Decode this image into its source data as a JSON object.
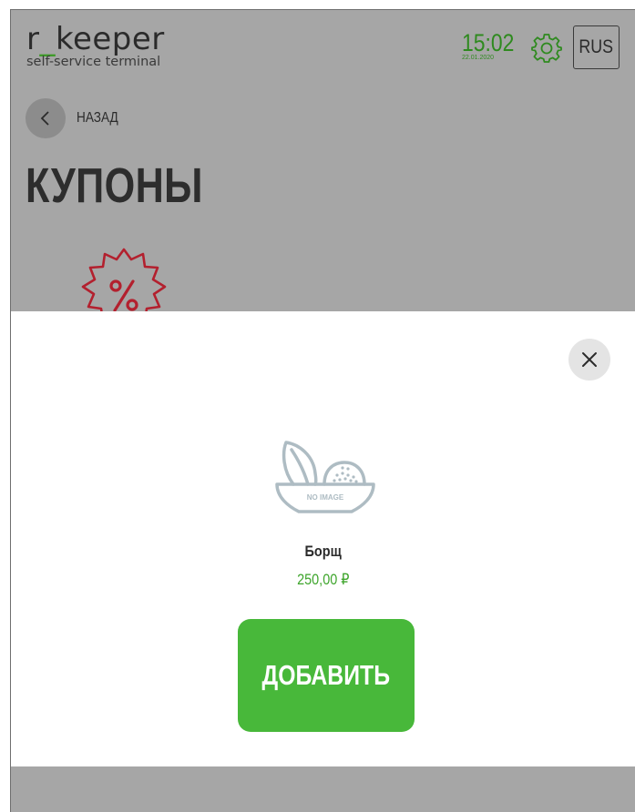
{
  "header": {
    "logo_prefix": "r",
    "logo_underscore": "_",
    "logo_suffix": "keeper",
    "logo_subtitle": "self-service terminal",
    "time": "15:02",
    "date": "22.01.2020",
    "language": "RUS",
    "settings_icon": "gear-icon"
  },
  "nav": {
    "back_label": "НАЗАД",
    "back_icon": "chevron-left-icon"
  },
  "page": {
    "title": "КУПОНЫ",
    "category_icon": "percent-badge-icon"
  },
  "modal": {
    "close_icon": "close-icon",
    "image_placeholder_text": "NO IMAGE",
    "product_name": "Борщ",
    "product_price": "250,00 ₽",
    "add_button_label": "ДОБАВИТЬ"
  },
  "colors": {
    "accent_green": "#48b83a",
    "price_green": "#3ea52c",
    "coupon_red": "#b3202e",
    "overlay_gray": "#a6a6a6"
  }
}
